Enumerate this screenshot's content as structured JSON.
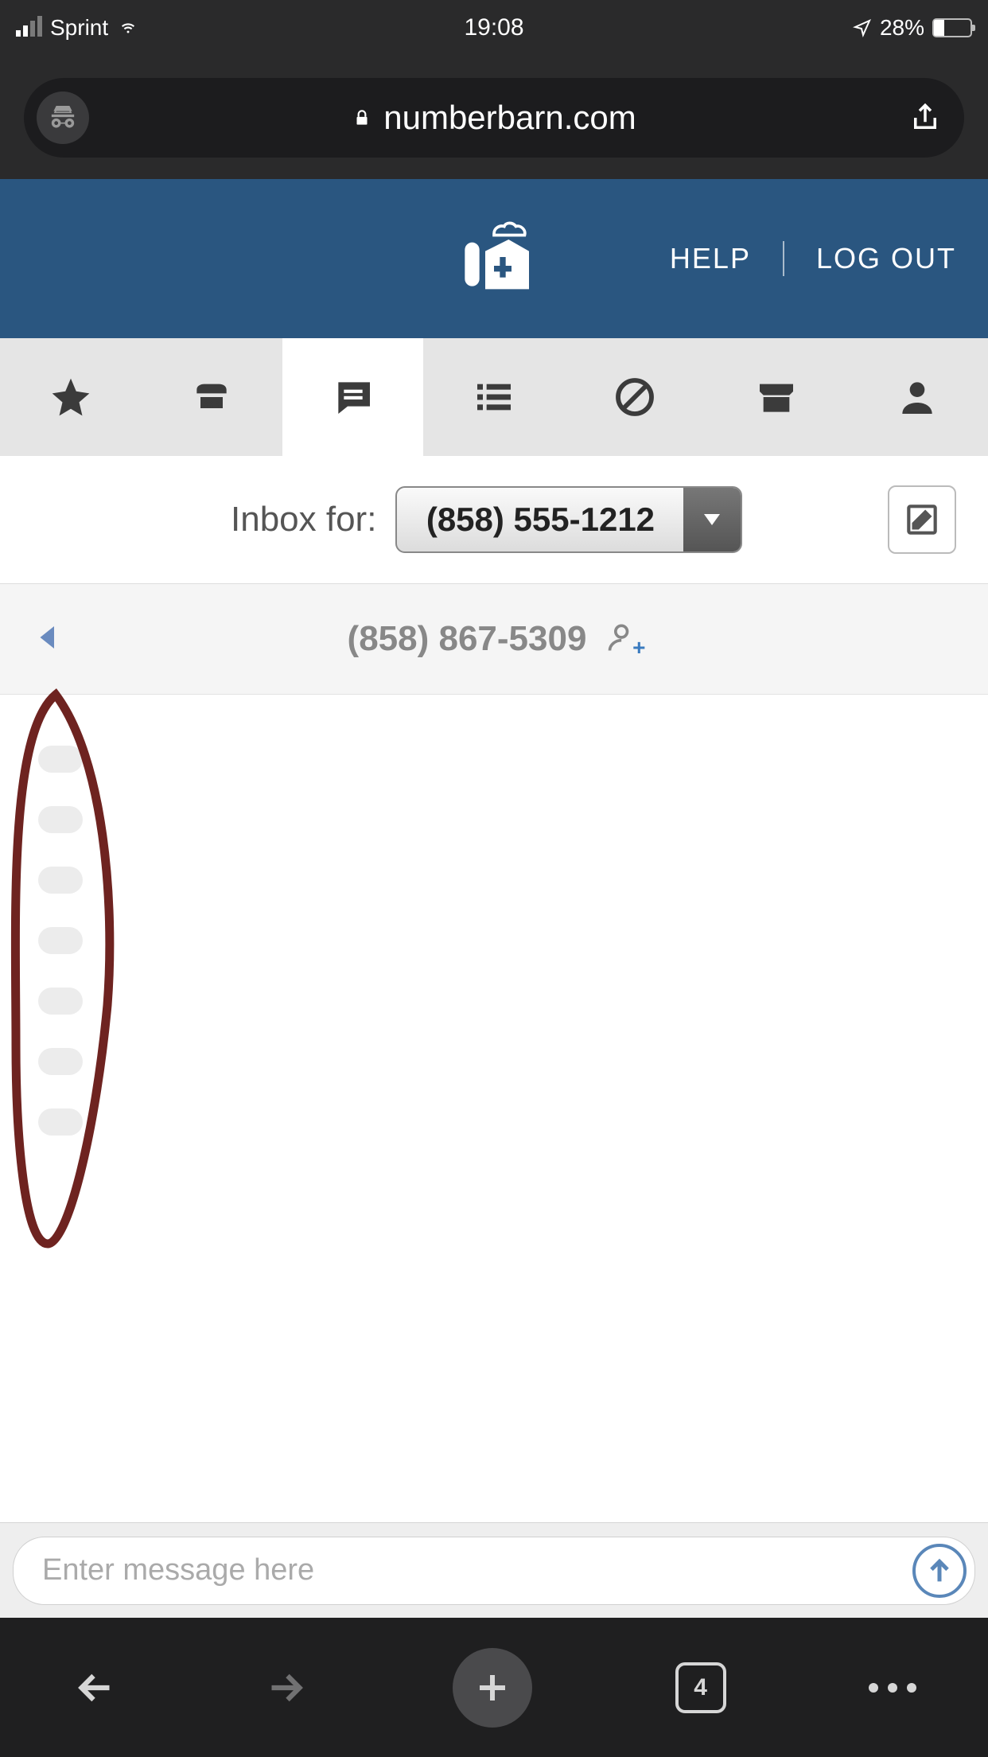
{
  "statusbar": {
    "carrier": "Sprint",
    "time": "19:08",
    "battery_pct": "28%"
  },
  "browser": {
    "url": "numberbarn.com",
    "tab_count": "4"
  },
  "header": {
    "help_label": "HELP",
    "logout_label": "LOG OUT"
  },
  "inbox": {
    "label": "Inbox for:",
    "selected_number": "(858) 555-1212"
  },
  "conversation": {
    "from_number": "(858) 867-5309"
  },
  "composer": {
    "placeholder": "Enter message here"
  }
}
